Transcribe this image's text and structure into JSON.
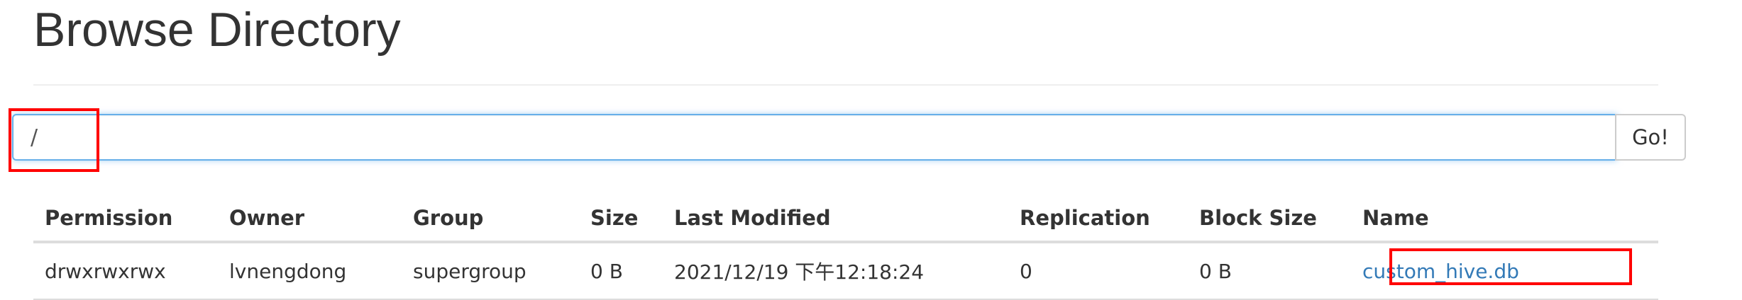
{
  "page": {
    "title": "Browse Directory"
  },
  "path_bar": {
    "value": "/",
    "go_label": "Go!"
  },
  "table": {
    "headers": {
      "permission": "Permission",
      "owner": "Owner",
      "group": "Group",
      "size": "Size",
      "last_modified": "Last Modified",
      "replication": "Replication",
      "block_size": "Block Size",
      "name": "Name"
    },
    "rows": [
      {
        "permission": "drwxrwxrwx",
        "owner": "lvnengdong",
        "group": "supergroup",
        "size": "0 B",
        "last_modified": "2021/12/19 下午12:18:24",
        "replication": "0",
        "block_size": "0 B",
        "name": "custom_hive.db"
      }
    ]
  },
  "colors": {
    "link": "#337ab7",
    "highlight": "#ff0000",
    "focus_border": "#66afe9"
  }
}
